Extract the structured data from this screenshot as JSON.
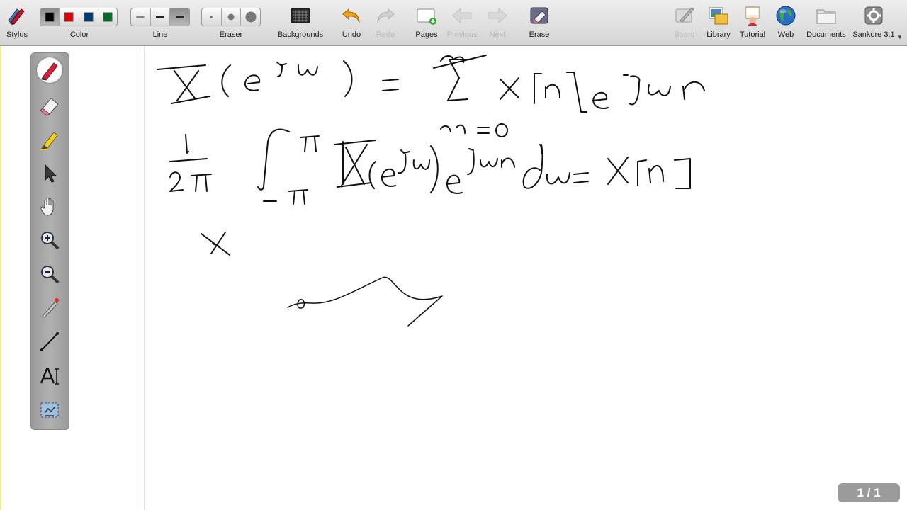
{
  "toolbar": {
    "stylus": "Stylus",
    "color": "Color",
    "line": "Line",
    "eraser": "Eraser",
    "backgrounds": "Backgrounds",
    "undo": "Undo",
    "redo": "Redo",
    "pages": "Pages",
    "previous": "Previous",
    "next": "Next",
    "erase": "Erase",
    "board": "Board",
    "library": "Library",
    "tutorial": "Tutorial",
    "web": "Web",
    "documents": "Documents",
    "app": "Sankore 3.1"
  },
  "colors": {
    "swatches": [
      "#000000",
      "#e00000",
      "#003c78",
      "#006e20"
    ],
    "selected_swatch": "#000000"
  },
  "palette_tools": [
    "pen-icon",
    "eraser-icon",
    "highlighter-icon",
    "pointer-icon",
    "hand-icon",
    "zoom-in-icon",
    "zoom-out-icon",
    "laser-pointer-icon",
    "line-icon",
    "text-icon",
    "capture-icon"
  ],
  "page_indicator": "1 / 1"
}
